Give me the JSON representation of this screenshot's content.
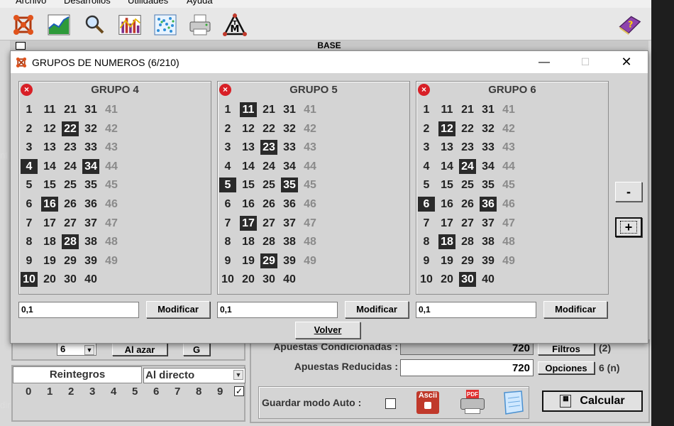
{
  "menu": [
    "Archivo",
    "Desarrollos",
    "Utilidades",
    "Ayuda"
  ],
  "toolbar_icons": [
    "network-icon",
    "area-chart-icon",
    "search-icon",
    "bar-chart-icon",
    "dot-matrix-icon",
    "printer-icon",
    "tm-logo-icon"
  ],
  "base_label": "BASE",
  "dialog": {
    "title": "GRUPOS DE NUMEROS (6/210)",
    "minimize": "—",
    "maximize": "☐",
    "close": "✕",
    "groups": [
      {
        "title": "GRUPO 4",
        "selected": [
          4,
          10,
          16,
          22,
          28,
          34
        ],
        "input_value": "0,1",
        "button": "Modificar"
      },
      {
        "title": "GRUPO 5",
        "selected": [
          5,
          11,
          17,
          23,
          29,
          35
        ],
        "input_value": "0,1",
        "button": "Modificar"
      },
      {
        "title": "GRUPO 6",
        "selected": [
          6,
          12,
          18,
          24,
          30,
          36
        ],
        "input_value": "0,1",
        "button": "Modificar"
      }
    ],
    "minus_label": "-",
    "plus_label": "+",
    "volver_label": "Volver",
    "close_glyph": "×"
  },
  "background": {
    "left_edge_texts": [
      "nt",
      "dir"
    ],
    "combo_value": "6",
    "al_azar": "Al azar",
    "g_button": "G",
    "reintegros": "Reintegros",
    "al_directo": "Al directo",
    "reintegro_digits": [
      "0",
      "1",
      "2",
      "3",
      "4",
      "5",
      "6",
      "7",
      "8",
      "9"
    ],
    "apuestas_condicionadas_label": "Apuestas Condicionadas :",
    "apuestas_condicionadas_value": "720",
    "filtros": "Filtros",
    "filtros_count": "(2)",
    "apuestas_reducidas_label": "Apuestas Reducidas :",
    "apuestas_reducidas_value": "720",
    "opciones": "Opciones",
    "opciones_count": "6 (n)",
    "guardar_label": "Guardar modo Auto :",
    "ascii_label": "Ascii",
    "pdf_label": "PDF",
    "calcular": "Calcular"
  }
}
